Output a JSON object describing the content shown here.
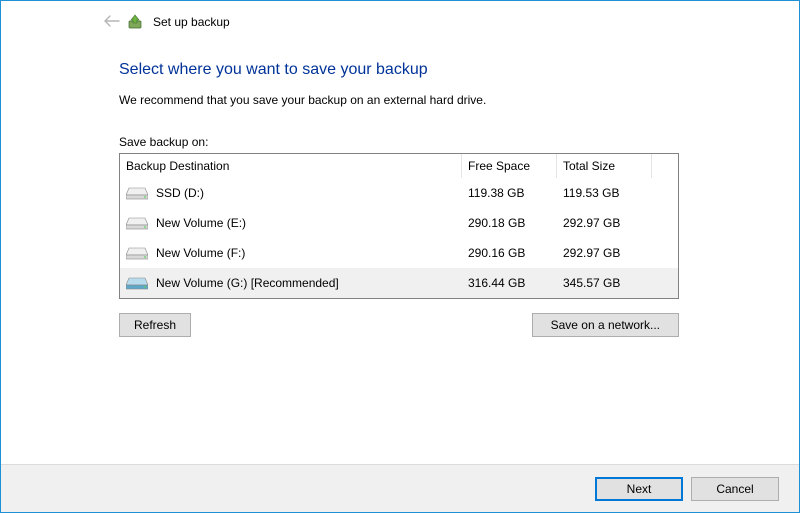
{
  "header": {
    "title": "Set up backup"
  },
  "page": {
    "heading": "Select where you want to save your backup",
    "subtext": "We recommend that you save your backup on an external hard drive.",
    "save_label": "Save backup on:"
  },
  "table": {
    "columns": {
      "destination": "Backup Destination",
      "free": "Free Space",
      "total": "Total Size"
    },
    "rows": [
      {
        "name": "SSD (D:)",
        "free": "119.38 GB",
        "total": "119.53 GB",
        "selected": false,
        "highlighted": false
      },
      {
        "name": "New Volume (E:)",
        "free": "290.18 GB",
        "total": "292.97 GB",
        "selected": false,
        "highlighted": false
      },
      {
        "name": "New Volume (F:)",
        "free": "290.16 GB",
        "total": "292.97 GB",
        "selected": false,
        "highlighted": false
      },
      {
        "name": "New Volume (G:) [Recommended]",
        "free": "316.44 GB",
        "total": "345.57 GB",
        "selected": true,
        "highlighted": true
      }
    ]
  },
  "buttons": {
    "refresh": "Refresh",
    "network": "Save on a network...",
    "next": "Next",
    "cancel": "Cancel"
  }
}
